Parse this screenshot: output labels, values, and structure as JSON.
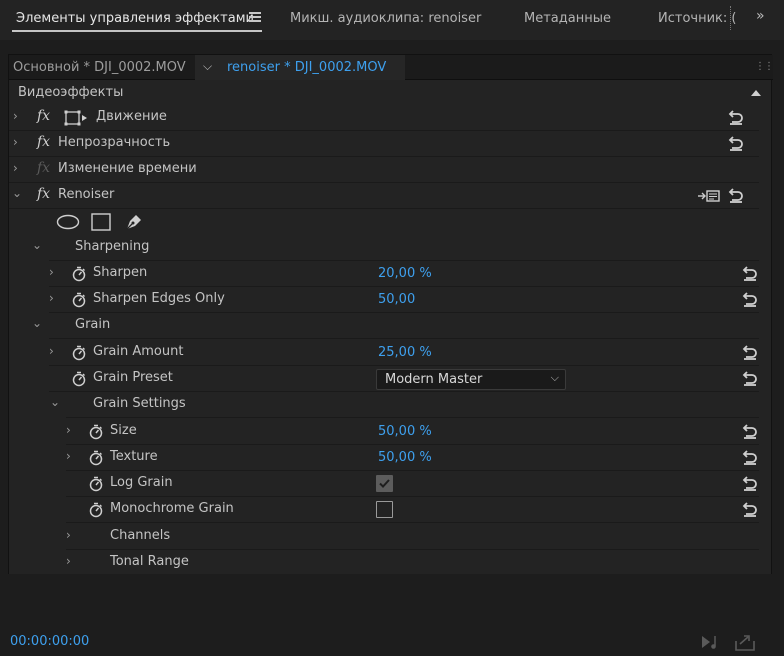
{
  "tabs": [
    {
      "label": "Элементы управления эффектами"
    },
    {
      "label": "Микш. аудиоклипа: renoiser"
    },
    {
      "label": "Метаданные"
    },
    {
      "label": "Источник: ("
    }
  ],
  "tab_more": "»",
  "clip_bar": {
    "master": "Основной * DJI_0002.MOV",
    "active": "renoiser * DJI_0002.MOV"
  },
  "section": {
    "label": "Видеоэффекты"
  },
  "effects": {
    "motion": "Движение",
    "opacity": "Непрозрачность",
    "time_remap": "Изменение времени",
    "renoiser": "Renoiser"
  },
  "fx_label": "fx",
  "params": {
    "sharpening_group": "Sharpening",
    "sharpen": {
      "label": "Sharpen",
      "value": "20,00 %"
    },
    "sharpen_edges": {
      "label": "Sharpen Edges Only",
      "value": "50,00"
    },
    "grain_group": "Grain",
    "grain_amount": {
      "label": "Grain Amount",
      "value": "25,00 %"
    },
    "grain_preset": {
      "label": "Grain Preset",
      "value": "Modern Master"
    },
    "grain_settings": "Grain Settings",
    "size": {
      "label": "Size",
      "value": "50,00 %"
    },
    "texture": {
      "label": "Texture",
      "value": "50,00 %"
    },
    "log_grain": {
      "label": "Log Grain",
      "checked": true
    },
    "monochrome": {
      "label": "Monochrome Grain",
      "checked": false
    },
    "channels": "Channels",
    "tonal_range": "Tonal Range"
  },
  "timecode": "00:00:00:00",
  "colors": {
    "accent": "#3ea0ee",
    "panel": "#232323",
    "background": "#1d1d1d"
  }
}
